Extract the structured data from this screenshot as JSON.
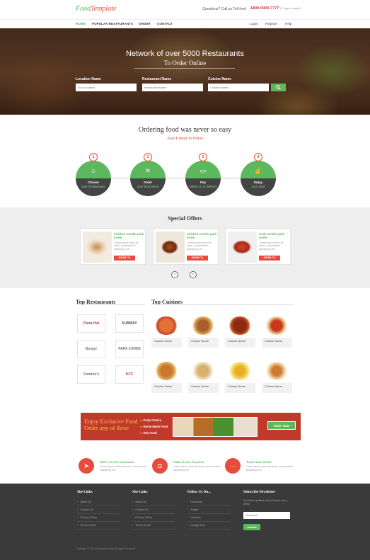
{
  "header": {
    "logo_food": "Food",
    "logo_template": "Template",
    "phone_question": "Questions? Call us Toll-free!",
    "phone_number": "1800-0000-7777",
    "phone_note": "(7 days a week)"
  },
  "nav": {
    "items": [
      "HOME",
      "POPULAR RESTAURANTS",
      "ORDER",
      "CONTACT"
    ],
    "right": [
      "Login",
      "Register",
      "Help"
    ]
  },
  "hero": {
    "title": "Network of over 5000 Restaurants",
    "subtitle": "To Order Online",
    "fields": [
      {
        "label": "Location Name",
        "placeholder": "Your Location"
      },
      {
        "label": "Restaurant Name",
        "placeholder": "Restaurant Name"
      },
      {
        "label": "Cuisine Name",
        "placeholder": "Cuisine Name"
      }
    ]
  },
  "steps": {
    "title": "Ordering food was never so easy",
    "subtitle": "Just 4 steps to follow",
    "items": [
      {
        "num": "1",
        "bold": "Choose",
        "rest": "your Restaurants"
      },
      {
        "num": "2",
        "bold": "Order",
        "rest": "your food items"
      },
      {
        "num": "3",
        "bold": "Pay",
        "rest": "online or on delivery"
      },
      {
        "num": "4",
        "bold": "Enjoy",
        "rest": "your food"
      }
    ]
  },
  "offers": {
    "title": "Special Offers",
    "items": [
      {
        "title": "Chicken Combo pack lorem",
        "text": "Lorem ipsum dolor sit amet, consectetuer adipiscing elit",
        "button": "GRAB IT>"
      },
      {
        "title": "Chicken Combo pack lorem",
        "text": "Lorem ipsum dolor sit amet, consectetuer adipiscing elit",
        "button": "GRAB IT>"
      },
      {
        "title": "Crab Combo pack lorem",
        "text": "Lorem ipsum dolor sit amet, consectetuer adipiscing elit",
        "button": "GRAB IT>"
      }
    ],
    "prev": "‹",
    "next": "›"
  },
  "restaurants": {
    "title": "Top Restaurants",
    "logos": [
      "Pizza Hut",
      "SUBWAY",
      "Burger",
      "PAPA JOHNS",
      "Domino's",
      "KFC"
    ]
  },
  "cuisines": {
    "title": "Top Cuisines",
    "items": [
      {
        "label": "Cuisine Name"
      },
      {
        "label": "Cuisine Name"
      },
      {
        "label": "Cuisine Name"
      },
      {
        "label": "Cuisine Name"
      },
      {
        "label": "Cuisine Name"
      },
      {
        "label": "Cuisine Name"
      },
      {
        "label": "Cuisine Name"
      },
      {
        "label": "Cuisine Name"
      }
    ]
  },
  "promo": {
    "title": "Enjoy Exclusive Food Order any of these",
    "bullets": [
      "Party Orders",
      "Home Made Food",
      "Diet Food"
    ],
    "button": "Order Now"
  },
  "features": [
    {
      "title": "100% Service Guarantee",
      "text": "Lorem ipsum dolor sit amet, consectetuer adipiscing elit"
    },
    {
      "title": "Fully Secure Payment",
      "text": "Lorem ipsum dolor sit amet, consectetuer adipiscing elit"
    },
    {
      "title": "Track Your Order",
      "text": "Lorem ipsum dolor sit amet, consectetuer adipiscing elit"
    }
  ],
  "footer": {
    "col1_title": "Site Links",
    "col1": [
      "About Us",
      "Contact Us",
      "Privacy Policy",
      "Terms of Use"
    ],
    "col2_title": "Site Links",
    "col2": [
      "About Us",
      "Contact Us",
      "Privacy Policy",
      "Terms of Use"
    ],
    "col3_title": "Follow Us On...",
    "col3": [
      "Facebook",
      "Twitter",
      "LinkedIn",
      "Google Plus"
    ],
    "newsletter_title": "Subscribe Newsletter",
    "newsletter_text": "Get latest updates and hot deals every week",
    "newsletter_placeholder": "Your email",
    "newsletter_button": "submit",
    "copyright": "Copyright © 2014 Company name All rights reserved"
  },
  "colors": {
    "green": "#5cb85c",
    "red": "#e74c3c",
    "dark": "#3a3a3a"
  }
}
